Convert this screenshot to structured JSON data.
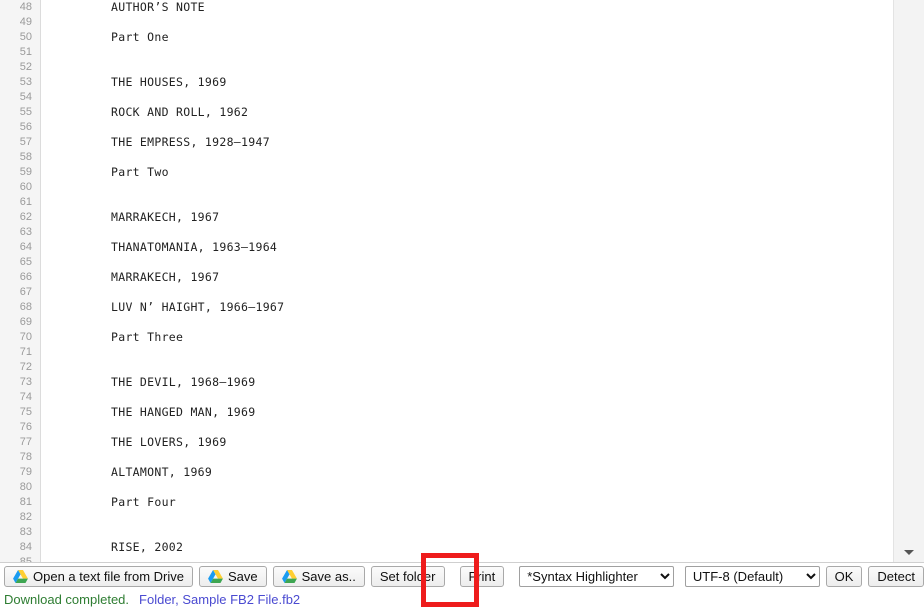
{
  "editor": {
    "first_line_number": 48,
    "lines": [
      {
        "n": 48,
        "text": "AUTHOR’S NOTE"
      },
      {
        "n": 49,
        "text": ""
      },
      {
        "n": 50,
        "text": "Part One"
      },
      {
        "n": 51,
        "text": ""
      },
      {
        "n": 52,
        "text": ""
      },
      {
        "n": 53,
        "text": "THE HOUSES, 1969"
      },
      {
        "n": 54,
        "text": ""
      },
      {
        "n": 55,
        "text": "ROCK AND ROLL, 1962"
      },
      {
        "n": 56,
        "text": ""
      },
      {
        "n": 57,
        "text": "THE EMPRESS, 1928–1947"
      },
      {
        "n": 58,
        "text": ""
      },
      {
        "n": 59,
        "text": "Part Two"
      },
      {
        "n": 60,
        "text": ""
      },
      {
        "n": 61,
        "text": ""
      },
      {
        "n": 62,
        "text": "MARRAKECH, 1967"
      },
      {
        "n": 63,
        "text": ""
      },
      {
        "n": 64,
        "text": "THANATOMANIA, 1963–1964"
      },
      {
        "n": 65,
        "text": ""
      },
      {
        "n": 66,
        "text": "MARRAKECH, 1967"
      },
      {
        "n": 67,
        "text": ""
      },
      {
        "n": 68,
        "text": "LUV N’ HAIGHT, 1966–1967"
      },
      {
        "n": 69,
        "text": ""
      },
      {
        "n": 70,
        "text": "Part Three"
      },
      {
        "n": 71,
        "text": ""
      },
      {
        "n": 72,
        "text": ""
      },
      {
        "n": 73,
        "text": "THE DEVIL, 1968–1969"
      },
      {
        "n": 74,
        "text": ""
      },
      {
        "n": 75,
        "text": "THE HANGED MAN, 1969"
      },
      {
        "n": 76,
        "text": ""
      },
      {
        "n": 77,
        "text": "THE LOVERS, 1969"
      },
      {
        "n": 78,
        "text": ""
      },
      {
        "n": 79,
        "text": "ALTAMONT, 1969"
      },
      {
        "n": 80,
        "text": ""
      },
      {
        "n": 81,
        "text": "Part Four"
      },
      {
        "n": 82,
        "text": ""
      },
      {
        "n": 83,
        "text": ""
      },
      {
        "n": 84,
        "text": "RISE, 2002"
      },
      {
        "n": 85,
        "text": ""
      }
    ]
  },
  "toolbar": {
    "open_label": "Open a text file from Drive",
    "save_label": "Save",
    "save_as_label": "Save as..",
    "set_folder_label": "Set folder",
    "print_label": "Print",
    "ok_label": "OK",
    "detect_label": "Detect",
    "syntax_selected": "*Syntax Highlighter",
    "syntax_options": [
      "*Syntax Highlighter"
    ],
    "encoding_selected": "UTF-8 (Default)",
    "encoding_options": [
      "UTF-8 (Default)"
    ]
  },
  "status": {
    "message": "Download completed.",
    "file": "Folder, Sample FB2 File.fb2",
    "message_color": "#2e7d32",
    "file_color": "#4a4ad1"
  },
  "annotation": {
    "highlight_color": "#ee1c1c",
    "target": "print-button"
  }
}
